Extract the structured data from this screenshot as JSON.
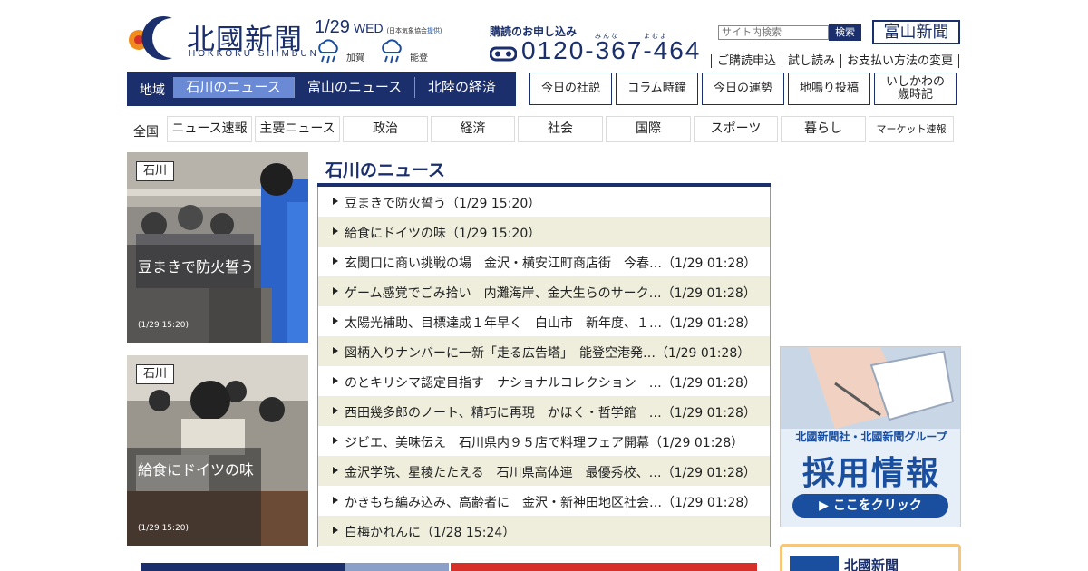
{
  "header": {
    "logo_title": "北國新聞",
    "logo_sub": "HOKKOKU SHIMBUN",
    "date": "1/29",
    "weekday": "WED",
    "weather_source_prefix": "(日本気象協会",
    "weather_source_link": "提供",
    "weather_source_suffix": ")",
    "weather": [
      {
        "label": "加賀",
        "icon": "rain-cloud-icon"
      },
      {
        "label": "能登",
        "icon": "rain-cloud-icon"
      }
    ],
    "subscribe_title": "購読のお申し込み",
    "subscribe_ruby": "みんな　　　よむよ",
    "phone": "0120-367-464",
    "search_placeholder": "サイト内検索",
    "search_button": "検索",
    "toyama_button": "富山新聞",
    "sub_links": [
      "ご購読申込",
      "試し読み",
      "お支払い方法の変更"
    ]
  },
  "region_nav": {
    "label": "地域",
    "tabs": [
      {
        "label": "石川のニュース",
        "active": true
      },
      {
        "label": "富山のニュース",
        "active": false
      },
      {
        "label": "北陸の経済",
        "active": false
      }
    ]
  },
  "box_links": [
    "今日の社説",
    "コラム時鐘",
    "今日の運勢",
    "地鳴り投稿",
    "いしかわの\n歳時記"
  ],
  "categories": {
    "all": "全国",
    "items": [
      "ニュース速報",
      "主要ニュース",
      "政治",
      "経済",
      "社会",
      "国際",
      "スポーツ",
      "暮らし",
      "マーケット速報"
    ]
  },
  "photo_cards": [
    {
      "tag": "石川",
      "caption": "豆まきで防火誓う",
      "time": "(1/29 15:20)"
    },
    {
      "tag": "石川",
      "caption": "給食にドイツの味",
      "time": "(1/29 15:20)"
    }
  ],
  "news": {
    "title": "石川のニュース",
    "items": [
      "豆まきで防火誓う（1/29 15:20）",
      "給食にドイツの味（1/29 15:20）",
      "玄関口に商い挑戦の場　金沢・横安江町商店街　今春…（1/29 01:28）",
      "ゲーム感覚でごみ拾い　内灘海岸、金大生らのサーク…（1/29 01:28）",
      "太陽光補助、目標達成１年早く　白山市　新年度、１…（1/29 01:28）",
      "図柄入りナンバーに一新「走る広告塔」　能登空港発…（1/29 01:28）",
      "のとキリシマ認定目指す　ナショナルコレクション　…（1/29 01:28）",
      "西田幾多郎のノート、精巧に再現　かほく・哲学館　…（1/29 01:28）",
      "ジビエ、美味伝え　石川県内９５店で料理フェア開幕（1/29 01:28）",
      "金沢学院、星稜たたえる　石川県高体連　最優秀校、…（1/29 01:28）",
      "かきもち編み込み、高齢者に　金沢・新神田地区社会…（1/29 01:28）",
      "白梅かれんに（1/28 15:24）"
    ]
  },
  "ads": {
    "recruit_sub": "北國新聞社・北國新聞グループ",
    "recruit_main": "採用情報",
    "recruit_button": "▶ ここをクリック",
    "bottom_title": "北國新聞"
  },
  "colors": {
    "brand": "#1a2f6b",
    "accent": "#6a8ad6",
    "alt_row": "#efeedd",
    "recruit": "#1a4fa0"
  }
}
